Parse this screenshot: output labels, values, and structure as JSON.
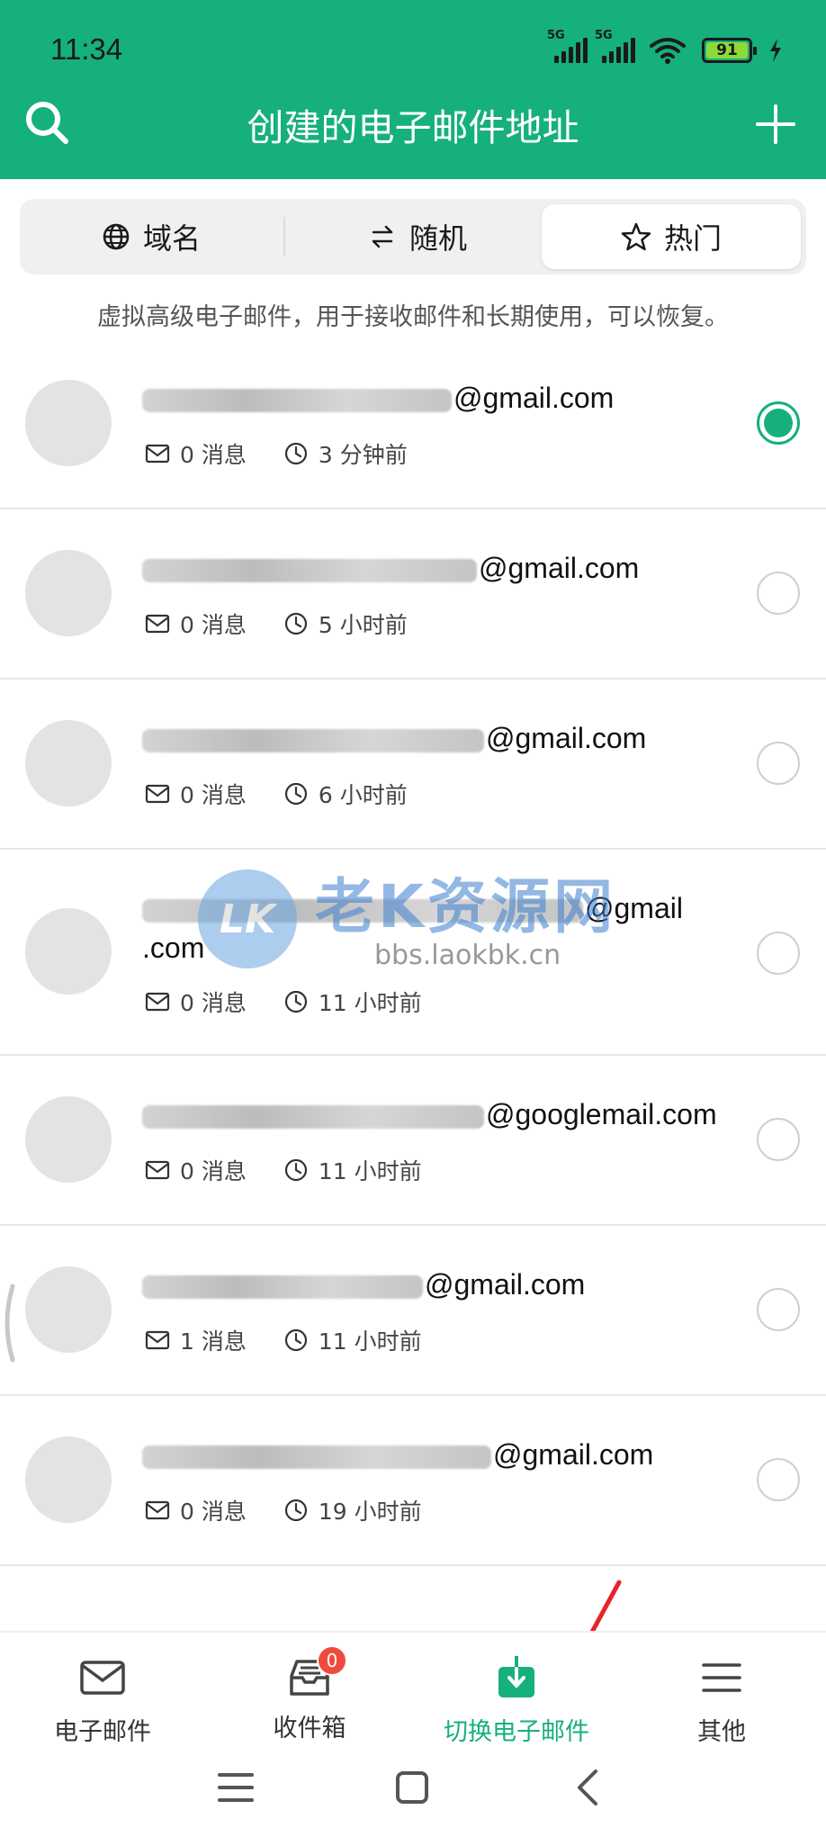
{
  "status_bar": {
    "time": "11:34",
    "network_1": "5G",
    "network_2": "5G",
    "battery": "91"
  },
  "header": {
    "title": "创建的电子邮件地址",
    "search_icon": "search-icon",
    "add_icon": "plus-icon",
    "bg_color": "#16b07c"
  },
  "tabs": [
    {
      "label": "域名",
      "icon": "globe-icon",
      "active": false
    },
    {
      "label": "随机",
      "icon": "swap-icon",
      "active": false
    },
    {
      "label": "热门",
      "icon": "star-icon",
      "active": true
    }
  ],
  "hint": "虚拟高级电子邮件，用于接收邮件和长期使用，可以恢复。",
  "emails": [
    {
      "domain": "@gmail.com",
      "messages": "0 消息",
      "time": "3 分钟前",
      "selected": true
    },
    {
      "domain": "@gmail.com",
      "messages": "0 消息",
      "time": "5 小时前",
      "selected": false
    },
    {
      "domain": "@gmail.com",
      "messages": "0 消息",
      "time": "6 小时前",
      "selected": false
    },
    {
      "domain": "@gmail",
      "domain_wrap": ".com",
      "messages": "0 消息",
      "time": "11 小时前",
      "selected": false
    },
    {
      "domain": "@googlemail.com",
      "messages": "0 消息",
      "time": "11 小时前",
      "selected": false
    },
    {
      "domain": "@gmail.com",
      "messages": "1 消息",
      "time": "11 小时前",
      "selected": false
    },
    {
      "domain": "@gmail.com",
      "messages": "0 消息",
      "time": "19 小时前",
      "selected": false
    }
  ],
  "watermark": {
    "title": "老K资源网",
    "url": "bbs.laokbk.cn",
    "logo_text": "LK"
  },
  "bottom_nav": [
    {
      "label": "电子邮件",
      "icon": "mail-icon",
      "active": false
    },
    {
      "label": "收件箱",
      "icon": "inbox-icon",
      "badge": "0",
      "active": false
    },
    {
      "label": "切换电子邮件",
      "icon": "download-box-icon",
      "active": true
    },
    {
      "label": "其他",
      "icon": "menu-icon",
      "active": false
    }
  ],
  "system_nav": [
    "menu-icon",
    "home-icon",
    "back-icon"
  ],
  "colors": {
    "accent": "#16b07c",
    "badge": "#ee4b3e",
    "arrow": "#e8232a"
  }
}
